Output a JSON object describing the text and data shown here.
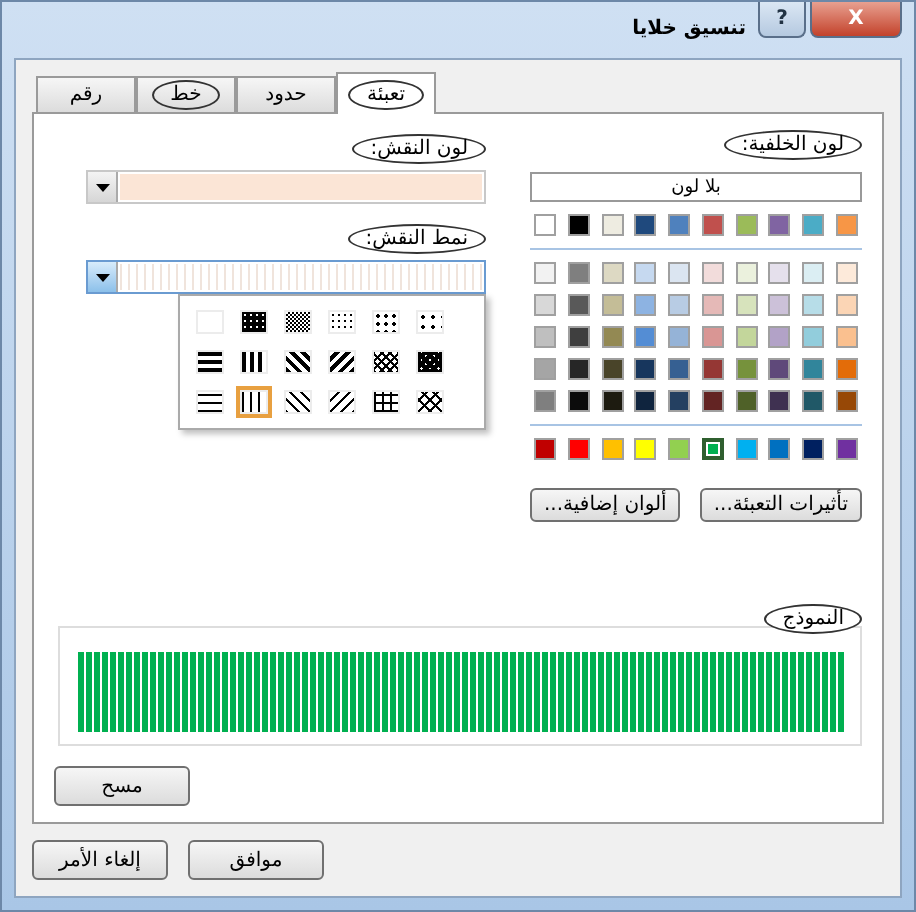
{
  "window": {
    "title": "تنسيق خلايا",
    "help": "?",
    "close": "X"
  },
  "tabs": [
    {
      "label": "تعبئة",
      "selected": true,
      "circled": true
    },
    {
      "label": "حدود",
      "selected": false,
      "circled": false
    },
    {
      "label": "خط",
      "selected": false,
      "circled": true
    },
    {
      "label": "رقم",
      "selected": false,
      "circled": false
    }
  ],
  "background_color": {
    "label": "لون الخلفية:",
    "circled": true,
    "no_color": "بلا لون",
    "theme_row": [
      {
        "color": "#ffffff",
        "selected": false
      },
      {
        "color": "#000000",
        "selected": false
      },
      {
        "color": "#eeece1",
        "selected": false
      },
      {
        "color": "#1f497d",
        "selected": false
      },
      {
        "color": "#4f81bd",
        "selected": false
      },
      {
        "color": "#c0504d",
        "selected": false
      },
      {
        "color": "#9bbb59",
        "selected": false
      },
      {
        "color": "#8064a2",
        "selected": false
      },
      {
        "color": "#4bacc6",
        "selected": false
      },
      {
        "color": "#f79646",
        "selected": false
      }
    ],
    "tint_rows": [
      [
        {
          "color": "#f2f2f2",
          "selected": false
        },
        {
          "color": "#7f7f7f",
          "selected": false
        },
        {
          "color": "#ddd9c3",
          "selected": false
        },
        {
          "color": "#c6d9f0",
          "selected": false
        },
        {
          "color": "#dbe5f1",
          "selected": false
        },
        {
          "color": "#f2dcdb",
          "selected": false
        },
        {
          "color": "#ebf1dd",
          "selected": false
        },
        {
          "color": "#e5e0ec",
          "selected": false
        },
        {
          "color": "#dbeef3",
          "selected": false
        },
        {
          "color": "#fdeada",
          "selected": false
        }
      ],
      [
        {
          "color": "#d8d8d8",
          "selected": false
        },
        {
          "color": "#595959",
          "selected": false
        },
        {
          "color": "#c4bd97",
          "selected": false
        },
        {
          "color": "#8db3e2",
          "selected": false
        },
        {
          "color": "#b8cce4",
          "selected": false
        },
        {
          "color": "#e5b9b7",
          "selected": false
        },
        {
          "color": "#d7e3bc",
          "selected": false
        },
        {
          "color": "#ccc1d9",
          "selected": false
        },
        {
          "color": "#b7dde8",
          "selected": false
        },
        {
          "color": "#fbd5b5",
          "selected": false
        }
      ],
      [
        {
          "color": "#bfbfbf",
          "selected": false
        },
        {
          "color": "#3f3f3f",
          "selected": false
        },
        {
          "color": "#938953",
          "selected": false
        },
        {
          "color": "#548dd4",
          "selected": false
        },
        {
          "color": "#95b3d7",
          "selected": false
        },
        {
          "color": "#d99694",
          "selected": false
        },
        {
          "color": "#c3d69b",
          "selected": false
        },
        {
          "color": "#b2a2c7",
          "selected": false
        },
        {
          "color": "#92cddc",
          "selected": false
        },
        {
          "color": "#fac08f",
          "selected": false
        }
      ],
      [
        {
          "color": "#a5a5a5",
          "selected": false
        },
        {
          "color": "#262626",
          "selected": false
        },
        {
          "color": "#494429",
          "selected": false
        },
        {
          "color": "#17365d",
          "selected": false
        },
        {
          "color": "#366092",
          "selected": false
        },
        {
          "color": "#953734",
          "selected": false
        },
        {
          "color": "#76923c",
          "selected": false
        },
        {
          "color": "#5f497a",
          "selected": false
        },
        {
          "color": "#31859b",
          "selected": false
        },
        {
          "color": "#e36c09",
          "selected": false
        }
      ],
      [
        {
          "color": "#7f7f7f",
          "selected": false
        },
        {
          "color": "#0c0c0c",
          "selected": false
        },
        {
          "color": "#1d1b10",
          "selected": false
        },
        {
          "color": "#0f243e",
          "selected": false
        },
        {
          "color": "#244061",
          "selected": false
        },
        {
          "color": "#632423",
          "selected": false
        },
        {
          "color": "#4f6128",
          "selected": false
        },
        {
          "color": "#3f3151",
          "selected": false
        },
        {
          "color": "#205867",
          "selected": false
        },
        {
          "color": "#974806",
          "selected": false
        }
      ]
    ],
    "standard_row": [
      {
        "color": "#c00000",
        "selected": false
      },
      {
        "color": "#ff0000",
        "selected": false
      },
      {
        "color": "#ffc000",
        "selected": false
      },
      {
        "color": "#ffff00",
        "selected": false
      },
      {
        "color": "#92d050",
        "selected": false
      },
      {
        "color": "#00b050",
        "selected": true
      },
      {
        "color": "#00b0f0",
        "selected": false
      },
      {
        "color": "#0070c0",
        "selected": false
      },
      {
        "color": "#002060",
        "selected": false
      },
      {
        "color": "#7030a0",
        "selected": false
      }
    ],
    "buttons": [
      "تأثيرات التعبئة...",
      "ألوان إضافية..."
    ]
  },
  "pattern_color": {
    "label": "لون النقش:",
    "circled": true,
    "color": "#fbe5d6"
  },
  "pattern_style": {
    "label": "نمط النقش:",
    "circled": true,
    "patterns": [
      {
        "kind": "solid",
        "selected": false
      },
      {
        "kind": "gray75",
        "selected": false
      },
      {
        "kind": "gray50",
        "selected": false
      },
      {
        "kind": "gray25",
        "selected": false
      },
      {
        "kind": "gray12",
        "selected": false
      },
      {
        "kind": "gray6",
        "selected": false
      },
      {
        "kind": "hstripe",
        "selected": false
      },
      {
        "kind": "vstripe",
        "selected": false
      },
      {
        "kind": "rdiag",
        "selected": false
      },
      {
        "kind": "diag",
        "selected": false
      },
      {
        "kind": "dcross",
        "selected": false
      },
      {
        "kind": "thickcross",
        "selected": false
      },
      {
        "kind": "thinh",
        "selected": false
      },
      {
        "kind": "thinv",
        "selected": true
      },
      {
        "kind": "thinrdiag",
        "selected": false
      },
      {
        "kind": "thindiag",
        "selected": false
      },
      {
        "kind": "thinhcross",
        "selected": false
      },
      {
        "kind": "thindcross",
        "selected": false
      }
    ]
  },
  "sample": {
    "label": "النموذج",
    "circled": true
  },
  "clear_button": "مسح",
  "footer_buttons": [
    "موافق",
    "إلغاء الأمر"
  ]
}
